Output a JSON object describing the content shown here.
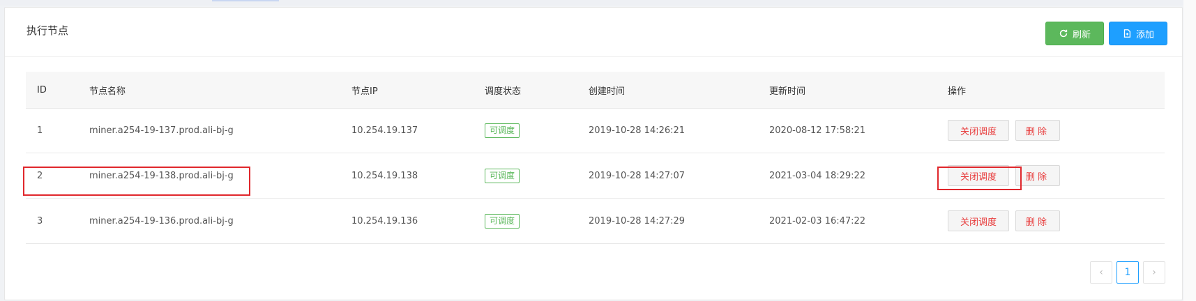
{
  "card": {
    "title": "执行节点"
  },
  "toolbar": {
    "refresh_label": "刷新",
    "add_label": "添加"
  },
  "table": {
    "headers": {
      "id": "ID",
      "name": "节点名称",
      "ip": "节点IP",
      "status": "调度状态",
      "created": "创建时间",
      "updated": "更新时间",
      "ops": "操作"
    },
    "rows": [
      {
        "id": "1",
        "name": "miner.a254-19-137.prod.ali-bj-g",
        "ip": "10.254.19.137",
        "status": "可调度",
        "created": "2019-10-28 14:26:21",
        "updated": "2020-08-12 17:58:21",
        "close": "关闭调度",
        "delete": "删除"
      },
      {
        "id": "2",
        "name": "miner.a254-19-138.prod.ali-bj-g",
        "ip": "10.254.19.138",
        "status": "可调度",
        "created": "2019-10-28 14:27:07",
        "updated": "2021-03-04 18:29:22",
        "close": "关闭调度",
        "delete": "删除"
      },
      {
        "id": "3",
        "name": "miner.a254-19-136.prod.ali-bj-g",
        "ip": "10.254.19.136",
        "status": "可调度",
        "created": "2019-10-28 14:27:29",
        "updated": "2021-02-03 16:47:22",
        "close": "关闭调度",
        "delete": "删除"
      }
    ]
  },
  "pagination": {
    "prev": "‹",
    "current": "1",
    "next": "›"
  },
  "colors": {
    "success": "#5cb85c",
    "primary": "#1e9fff",
    "danger": "#e83d3d",
    "highlight": "#e0272c"
  }
}
